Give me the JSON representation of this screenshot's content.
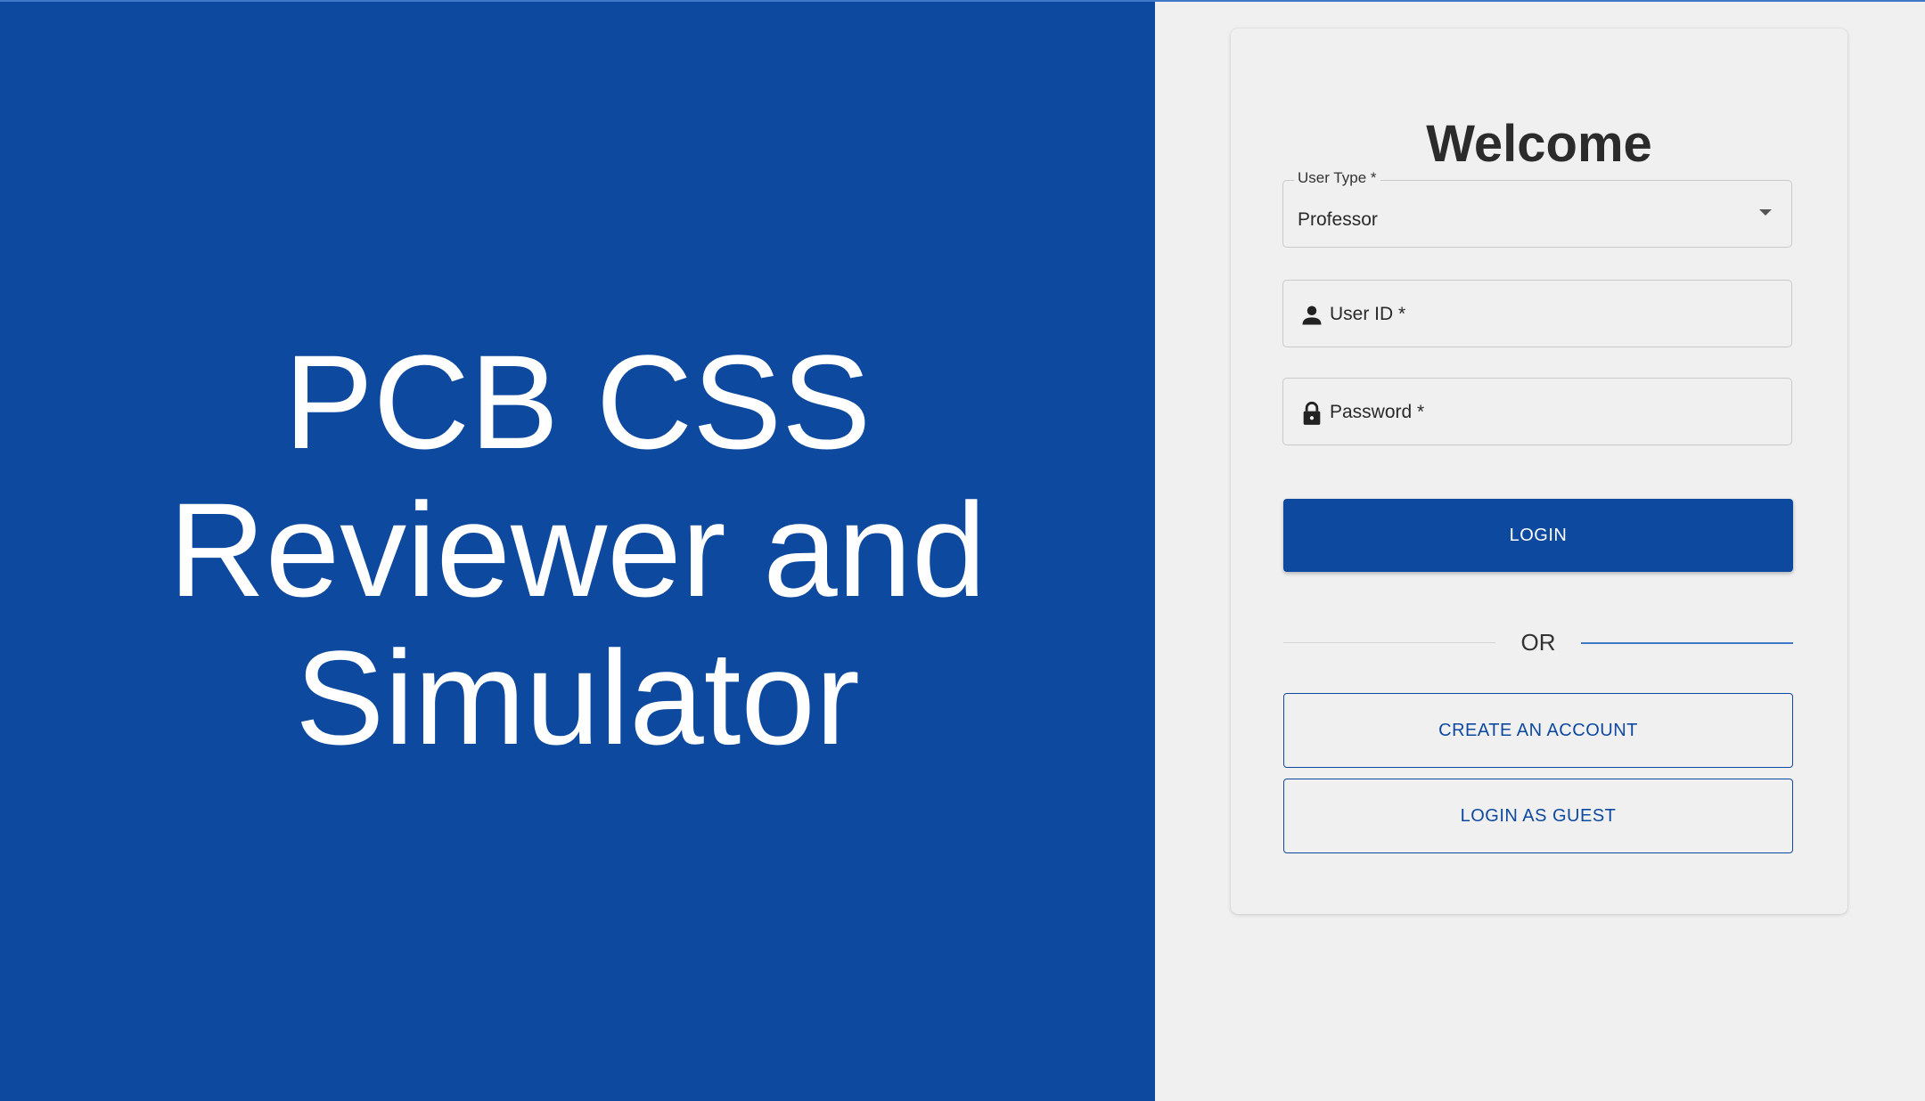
{
  "hero": {
    "title": "PCB CSS\nReviewer and\nSimulator"
  },
  "login_card": {
    "welcome": "Welcome",
    "user_type": {
      "label": "User Type *",
      "value": "Professor"
    },
    "user_id": {
      "label": "User ID *",
      "icon": "user-icon"
    },
    "password": {
      "label": "Password *",
      "icon": "lock-icon"
    },
    "login_button": "LOGIN",
    "divider_text": "OR",
    "create_account_button": "CREATE AN ACCOUNT",
    "guest_button": "LOGIN AS GUEST"
  },
  "colors": {
    "primary": "#0e49a0",
    "background": "#f0f0f0",
    "text": "#2b2b2b"
  }
}
